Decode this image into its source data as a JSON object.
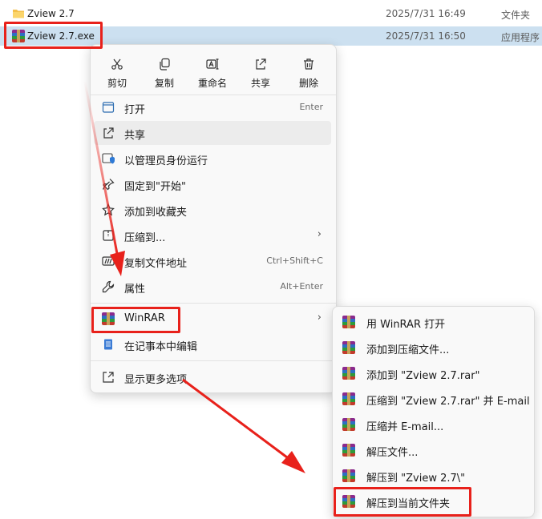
{
  "files": [
    {
      "name": "Zview 2.7",
      "date": "2025/7/31 16:49",
      "type": "文件夹",
      "icon": "folder-icon"
    },
    {
      "name": "Zview 2.7.exe",
      "date": "2025/7/31 16:50",
      "type": "应用程序",
      "icon": "winrar-icon"
    }
  ],
  "quick_actions": [
    {
      "label": "剪切",
      "icon": "scissors-icon"
    },
    {
      "label": "复制",
      "icon": "copy-icon"
    },
    {
      "label": "重命名",
      "icon": "rename-icon"
    },
    {
      "label": "共享",
      "icon": "share-icon"
    },
    {
      "label": "删除",
      "icon": "trash-icon"
    }
  ],
  "menu_items": [
    {
      "label": "打开",
      "accel": "Enter",
      "icon": "open-icon"
    },
    {
      "label": "共享",
      "accel": "",
      "icon": "share-icon"
    },
    {
      "label": "以管理员身份运行",
      "accel": "",
      "icon": "shield-icon"
    },
    {
      "label": "固定到\"开始\"",
      "accel": "",
      "icon": "pin-icon"
    },
    {
      "label": "添加到收藏夹",
      "accel": "",
      "icon": "star-icon"
    },
    {
      "label": "压缩到...",
      "accel": "",
      "icon": "archive-icon"
    },
    {
      "label": "复制文件地址",
      "accel": "Ctrl+Shift+C",
      "icon": "path-icon"
    },
    {
      "label": "属性",
      "accel": "Alt+Enter",
      "icon": "wrench-icon"
    },
    {
      "label": "WinRAR",
      "accel": "",
      "icon": "winrar-icon"
    },
    {
      "label": "在记事本中编辑",
      "accel": "",
      "icon": "notepad-icon"
    },
    {
      "label": "显示更多选项",
      "accel": "",
      "icon": "more-options-icon"
    }
  ],
  "submenu_items": [
    {
      "label": "用 WinRAR 打开"
    },
    {
      "label": "添加到压缩文件..."
    },
    {
      "label": "添加到 \"Zview 2.7.rar\""
    },
    {
      "label": "压缩到 \"Zview 2.7.rar\" 并 E-mail"
    },
    {
      "label": "压缩并 E-mail..."
    },
    {
      "label": "解压文件..."
    },
    {
      "label": "解压到 \"Zview 2.7\\\""
    },
    {
      "label": "解压到当前文件夹"
    }
  ],
  "colors": {
    "highlight": "#e8211b",
    "selected_row": "#cce0f0",
    "menu_bg": "#f9f9f9"
  }
}
